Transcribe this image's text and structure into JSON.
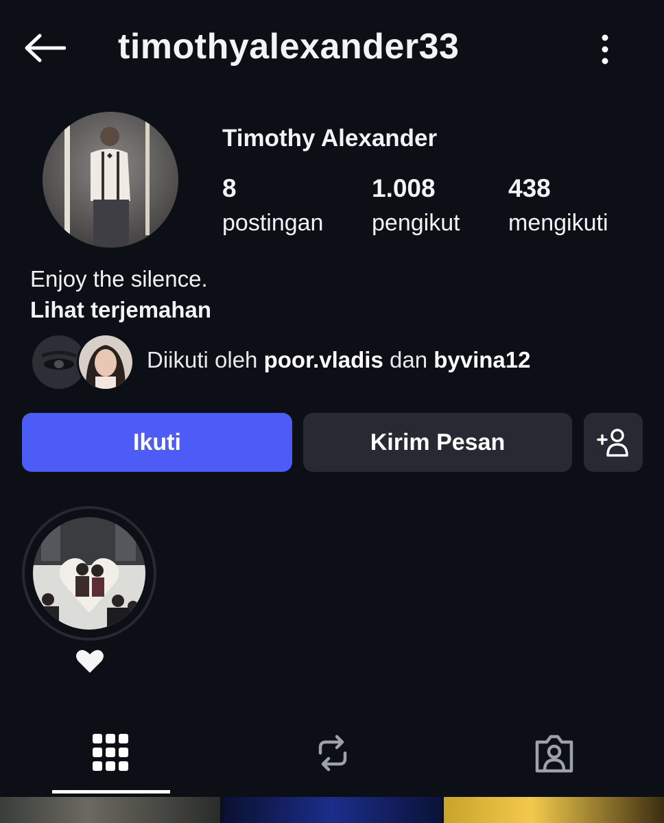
{
  "header": {
    "username": "timothyalexander33",
    "back_icon": "arrow-left-icon",
    "more_icon": "more-vertical-icon"
  },
  "profile": {
    "display_name": "Timothy Alexander",
    "stats": [
      {
        "value": "8",
        "label": "postingan"
      },
      {
        "value": "1.008",
        "label": "pengikut"
      },
      {
        "value": "438",
        "label": "mengikuti"
      }
    ],
    "bio": "Enjoy the silence.",
    "translate_label": "Lihat terjemahan"
  },
  "followed_by": {
    "prefix": "Diikuti oleh",
    "user1": "poor.vladis",
    "conjunction": "dan",
    "user2": "byvina12"
  },
  "actions": {
    "follow_label": "Ikuti",
    "message_label": "Kirim Pesan",
    "suggest_icon": "add-person-icon"
  },
  "highlights": [
    {
      "label_icon": "heart-icon"
    }
  ],
  "tabs": [
    {
      "icon": "grid-icon",
      "selected": true
    },
    {
      "icon": "reels-repost-icon",
      "selected": false
    },
    {
      "icon": "tagged-person-icon",
      "selected": false
    }
  ],
  "colors": {
    "background": "#0d0f16",
    "accent": "#4e5cf7",
    "secondary_button": "#272a33"
  }
}
